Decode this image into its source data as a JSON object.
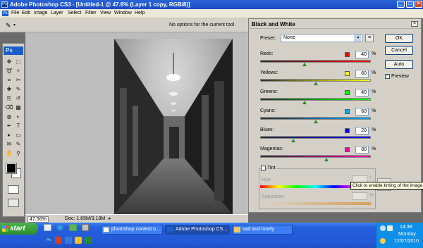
{
  "window": {
    "title": "Adobe Photoshop CS3 - [Untitled-1 @ 47.6% (Layer 1 copy, RGB/8)]",
    "logo": "Ps"
  },
  "menu": [
    "File",
    "Edit",
    "Image",
    "Layer",
    "Select",
    "Filter",
    "View",
    "Window",
    "Help"
  ],
  "options_bar": {
    "message": "No options for the current tool."
  },
  "status_bar": {
    "zoom": "47.56%",
    "doc": "Doc: 1.65M/3.18M"
  },
  "tools": {
    "logo": "Ps",
    "icons": [
      "move-icon",
      "marquee-icon",
      "lasso-icon",
      "magic-wand-icon",
      "crop-icon",
      "slice-icon",
      "healing-icon",
      "brush-icon",
      "clone-stamp-icon",
      "history-brush-icon",
      "eraser-icon",
      "gradient-icon",
      "blur-icon",
      "dodge-icon",
      "pen-icon",
      "type-icon",
      "path-select-icon",
      "shape-icon",
      "notes-icon",
      "eyedropper-icon",
      "hand-icon",
      "zoom-icon"
    ],
    "foreground_color": "#000000",
    "background_color": "#ffffff"
  },
  "dialog": {
    "title": "Black and White",
    "preset_label": "Preset:",
    "preset_value": "None",
    "buttons": {
      "ok": "OK",
      "cancel": "Cancel",
      "auto": "Auto"
    },
    "preview_label": "Preview",
    "preview_checked": true,
    "channels": [
      {
        "label": "Reds:",
        "value": "40",
        "unit": "%",
        "color": "#ff0000",
        "fraction": 0.4
      },
      {
        "label": "Yellows:",
        "value": "60",
        "unit": "%",
        "color": "#ffff00",
        "fraction": 0.6
      },
      {
        "label": "Greens:",
        "value": "40",
        "unit": "%",
        "color": "#00ff00",
        "fraction": 0.4
      },
      {
        "label": "Cyans:",
        "value": "60",
        "unit": "%",
        "color": "#00aaff",
        "fraction": 0.6
      },
      {
        "label": "Blues:",
        "value": "20",
        "unit": "%",
        "color": "#0000ff",
        "fraction": 0.2
      },
      {
        "label": "Magentas:",
        "value": "80",
        "unit": "%",
        "color": "#ff00aa",
        "fraction": 0.8
      }
    ],
    "tint": {
      "label": "Tint",
      "checked": false,
      "tooltip": "Click to enable tinting of the image",
      "hue_label": "Hue",
      "hue_unit": "°",
      "saturation_label": "Saturation",
      "saturation_unit": "%"
    }
  },
  "taskbar": {
    "start_label": "start",
    "tasks": [
      {
        "label": "photoshop contest o...",
        "active": false
      },
      {
        "label": "Adobe Photoshop CS...",
        "active": true
      },
      {
        "label": "sad and lonely",
        "active": false
      }
    ],
    "clock": {
      "time": "14:38",
      "day": "Monday",
      "date": "12/07/2010"
    }
  }
}
